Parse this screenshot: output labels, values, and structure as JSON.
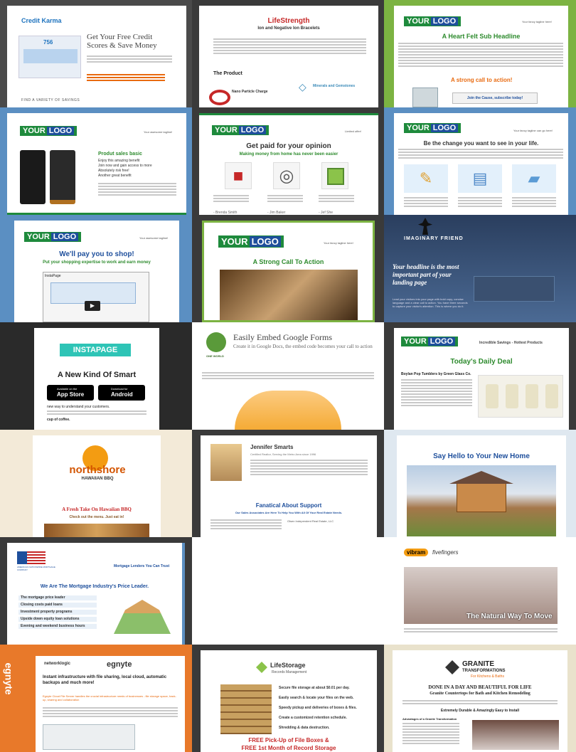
{
  "tiles": {
    "t1": {
      "brand": "Credit Karma",
      "headline": "Get Your Free Credit Scores & Save Money",
      "score": "756",
      "footer": "FIND A VARIETY OF SAVINGS"
    },
    "t2": {
      "title": "LifeStrength",
      "subtitle": "Ion and Negative Ion Bracelets",
      "section": "The Product",
      "feature1": "Nano Particle Charge",
      "feature2": "Minerals and Gemstones"
    },
    "t3": {
      "logo_a": "YOUR",
      "logo_b": "LOGO",
      "tagline": "Your fancy tagline here!",
      "headline": "A Heart Felt Sub Headline",
      "cta": "A strong call to action!",
      "button": "Join the Cause, subscribe today!"
    },
    "t4": {
      "logo_a": "YOUR",
      "logo_b": "LOGO",
      "tagline": "Your awesome tagline!",
      "headline": "Produt sales basic",
      "bullets": [
        "Enjoy this amazing benefit",
        "Join now and gain access to more",
        "Absolutely risk free!",
        "Another great benefit"
      ]
    },
    "t5": {
      "logo_a": "YOUR",
      "logo_b": "LOGO",
      "tagline": "Limited offer!",
      "headline": "Get paid for your opinion",
      "sub": "Making money from home has never been easier",
      "names": [
        "- Brenda Smith",
        "- Jim Baker",
        "- Jef She"
      ]
    },
    "t6": {
      "logo_a": "YOUR",
      "logo_b": "LOGO",
      "tagline": "Your fancy tagline can go here!",
      "headline": "Be the change you want to see in your life."
    },
    "t7": {
      "logo_a": "YOUR",
      "logo_b": "LOGO",
      "tagline": "Your awesome tagline!",
      "headline": "We'll pay you to shop!",
      "sub": "Put your shopping expertise to work and earn money",
      "video_label": "InstaPage"
    },
    "t8": {
      "logo_a": "YOUR",
      "logo_b": "LOGO",
      "tagline": "Your fancy tagline here!",
      "headline": "A Strong Call To Action"
    },
    "t9": {
      "brand": "IMAGINARY FRIEND",
      "headline": "Your headline is the most important part of your landing page",
      "body": "Lead your visitors into your page with bold copy, concise language and a clear call to action. You have three seconds to capture your visitor's attention. This is where you do it."
    },
    "t10": {
      "brand": "INSTAPAGE",
      "headline": "A New Kind Of Smart",
      "app_store": "App Store",
      "app_store_pre": "Available on the",
      "android": "Android",
      "android_pre": "Download for",
      "body_bold": "new way to understand your customers.",
      "tail": "cup of coffee."
    },
    "t11": {
      "headline": "Easily Embed Google Forms",
      "sub": "Create it in Google Docs, the embed code becomes your call to action",
      "brand": "ONE WORLD"
    },
    "t12": {
      "logo_a": "YOUR",
      "logo_b": "LOGO",
      "tagline": "Incredible Savings - Hottest Products",
      "headline": "Today's Daily Deal",
      "product": "Boylan Pop Tumblers by Green Glass Co."
    },
    "t13": {
      "brand": "northshore",
      "brand_sub": "HAWAIIAN BBQ",
      "headline": "A Fresh Take On Hawaiian BBQ",
      "sub": "Check out the menu. Just eat in!"
    },
    "t14": {
      "name": "Jennifer Smarts",
      "role": "Certified Realtor, Serving the Metro Area since 1996",
      "section": "Fanatical About Support",
      "sub": "Our Sales Associates Are Here To Help You With All Of Your Real Estate Needs.",
      "office": "Olsen Independent Real Estate, LLC"
    },
    "t15": {
      "headline": "Say Hello to Your New Home"
    },
    "t16": {
      "brand": "AMERICAN NATIONWIDE MORTGAGE COMPANY",
      "tagline": "Mortgage Lenders You Can Trust",
      "headline": "We Are The Mortgage Industry's Price Leader.",
      "bullets": [
        "The mortgage price leader",
        "Closing costs paid loans",
        "Investment property programs",
        "Upside down equity loan solutions",
        "Evening and weekend business hours"
      ]
    },
    "t18": {
      "brand": "vibram",
      "brand_sub": "fivefingers",
      "overlay": "The Natural Way To Move"
    },
    "t19": {
      "side": "egnyte",
      "partner": "networklogic",
      "brand": "egnyte",
      "headline": "Instant infrastructure with file sharing, local cloud, automatic backups and much more!",
      "sub": "Egnyte Cloud File Server handles the crucial infrastructure needs of businesses - file storage space, back-up, sharing and collaboration"
    },
    "t20": {
      "brand": "LifeStorage",
      "brand_sub": "Records Management",
      "bullets": [
        "Secure file storage at about $0.01 per day.",
        "Easily search & locate your files on the web.",
        "Speedy pickup and deliveries of boxes & files.",
        "Create a customized retention schedule.",
        "Shredding & data destruction."
      ],
      "footer1": "FREE Pick-Up of File Boxes &",
      "footer2": "FREE 1st Month of Record Storage"
    },
    "t21": {
      "brand": "GRANITE",
      "brand_sub": "TRANSFORMATIONS",
      "brand_sub2": "For Kitchens & Baths",
      "headline": "DONE IN A DAY AND BEAUTIFUL FOR LIFE",
      "sub": "Granite Countertops for Bath and Kitchen Remodeling",
      "tag": "Extremely Durable & Amazingly Easy to Install",
      "list_title": "Advantages of a Granite Transformation"
    }
  },
  "colors": {
    "green": "#1e8a3c",
    "blue": "#1e4f9c",
    "red": "#c62828",
    "orange": "#e86a10"
  }
}
